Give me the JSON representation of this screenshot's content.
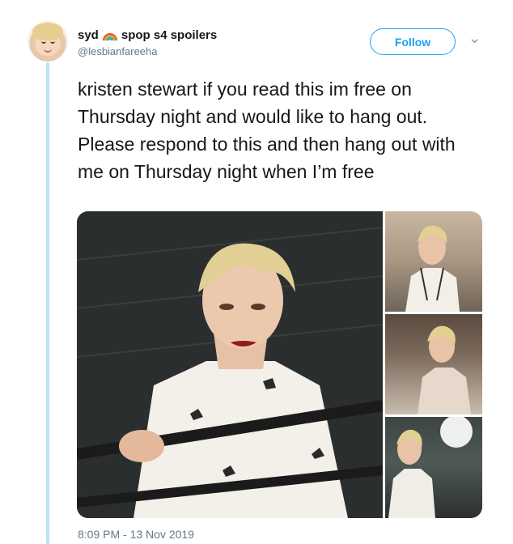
{
  "user": {
    "display_name": "syd",
    "display_name_suffix": "spop s4 spoilers",
    "handle": "@lesbianfareeha",
    "emoji_icon": "rainbow-icon"
  },
  "actions": {
    "follow_label": "Follow",
    "more_icon": "chevron-down-icon"
  },
  "tweet": {
    "text": "kristen stewart if you read this im free on Thursday night and would like to hang out. Please respond to this and then hang out with me on Thursday night when I’m free",
    "timestamp": "8:09 PM - 13 Nov 2019"
  },
  "colors": {
    "accent": "#1da1f2",
    "thread_line": "#b8e2f8",
    "secondary_text": "#657786"
  }
}
